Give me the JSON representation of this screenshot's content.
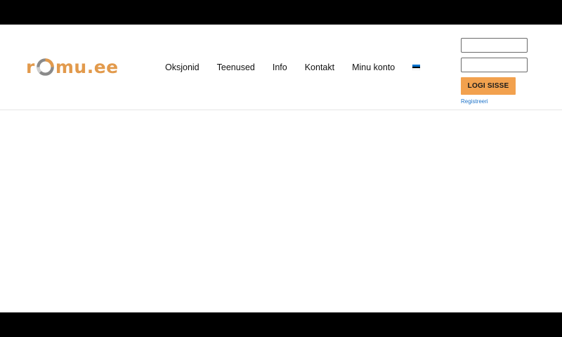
{
  "brand": {
    "logo_prefix": "r",
    "logo_suffix": "mu.ee",
    "colors": {
      "accent": "#e29a4c",
      "ring": "#8a8a8a"
    }
  },
  "nav": {
    "items": [
      {
        "label": "Oksjonid"
      },
      {
        "label": "Teenused"
      },
      {
        "label": "Info"
      },
      {
        "label": "Kontakt"
      },
      {
        "label": "Minu konto"
      }
    ],
    "language_icon": "estonia-flag-icon"
  },
  "login": {
    "username_value": "",
    "password_value": "",
    "button_label": "LOGI SISSE",
    "register_label": "Registreeri",
    "button_color": "#f2a14e",
    "link_color": "#1f74c9"
  }
}
